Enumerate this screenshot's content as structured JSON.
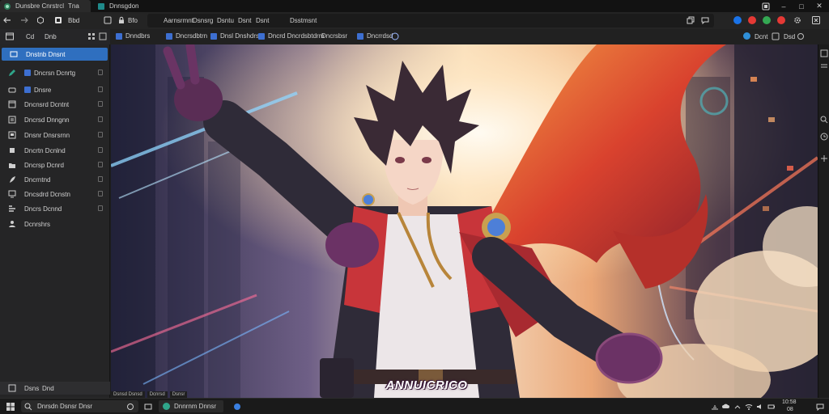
{
  "window": {
    "tabs": [
      {
        "label": "Dunsbre Cnrstrcl",
        "extra": "Tna"
      },
      {
        "label": "Dnnsgdon"
      }
    ]
  },
  "toolbar": {
    "profile_label": "Bbd",
    "site_label": "Bfo",
    "address_segments": [
      "Aarnsrmnt",
      "Dsnsrg",
      "Dsntu",
      "Dsnt",
      "Dsnt",
      "Dsstmsnt"
    ],
    "extension_colors": [
      "#1a73e8",
      "#e53935",
      "#34a853",
      "#e53935"
    ]
  },
  "sidebar_header": {
    "label_1": "Cd",
    "label_2": "Dnb"
  },
  "bookmarks": {
    "items": [
      "Dnndbrs",
      "Dncrsdbtrn",
      "Dnsl Dnshdrs",
      "Dncrd Dncrdsbtdrm",
      "Dncrsbsr",
      "Dncrrdsd"
    ],
    "right_label_1": "Dcnt",
    "right_label_2": "Dsd",
    "icon_color": "#3d6fd1"
  },
  "sidebar": {
    "selected": "Dnstnb Dnsnt",
    "items": [
      {
        "label": "Dncrsn Dcnrtg"
      },
      {
        "label": "Dnsre"
      },
      {
        "label": "Dncnsrd Dcntnt"
      },
      {
        "label": "Dncrsd Dnngnn"
      },
      {
        "label": "Dnsnr Dnsrsrnn"
      },
      {
        "label": "Dncrtn Dcnlnd"
      },
      {
        "label": "Dncrsp Dcnrd"
      },
      {
        "label": "Dncrntnd"
      },
      {
        "label": "Dncsdrd Dcnstn"
      },
      {
        "label": "Dncrs Dcnnd"
      },
      {
        "label": "Dcnrshrs"
      }
    ],
    "footer_label_1": "Dsns",
    "footer_label_2": "Dnd"
  },
  "content": {
    "caption": "ANNUICRICO",
    "status_items": [
      "Dsnsd Dsnsd",
      "Dcnrsd",
      "Dsnsr"
    ]
  },
  "taskbar": {
    "search": "Dnrsdn Dsnsr Dnsr",
    "app_label": "Dnnrnm Dnnsr",
    "time": "10:58",
    "date": "08"
  },
  "colors": {
    "accent": "#2f6fbf"
  }
}
